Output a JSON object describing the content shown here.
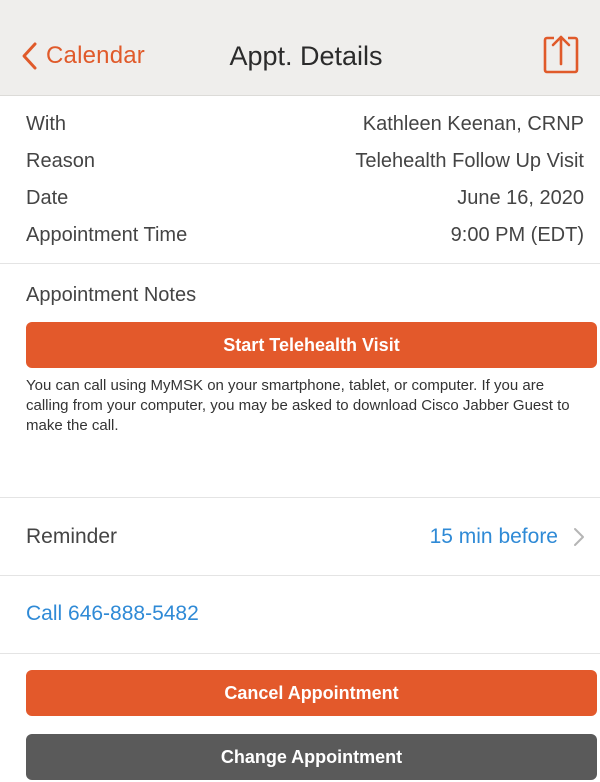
{
  "header": {
    "back_label": "Calendar",
    "title": "Appt. Details",
    "share_icon": "share-icon"
  },
  "details": [
    {
      "label": "With",
      "value": "Kathleen Keenan, CRNP"
    },
    {
      "label": "Reason",
      "value": "Telehealth Follow Up Visit"
    },
    {
      "label": "Date",
      "value": "June 16, 2020"
    },
    {
      "label": "Appointment Time",
      "value": "9:00 PM (EDT)"
    }
  ],
  "notes": {
    "heading": "Appointment Notes",
    "telehealth_button": "Start Telehealth Visit",
    "text": "You can call using MyMSK on your smartphone, tablet, or computer. If you are calling from your computer, you may be asked to download Cisco Jabber Guest to make the call."
  },
  "reminder": {
    "label": "Reminder",
    "value": "15 min before"
  },
  "call": {
    "label": "Call 646-888-5482"
  },
  "actions": {
    "cancel_label": "Cancel Appointment",
    "change_label": "Change Appointment"
  },
  "colors": {
    "accent": "#e3592b",
    "link": "#2f8ad6",
    "dark_button": "#5a5a5a",
    "header_bg": "#efeeec"
  }
}
